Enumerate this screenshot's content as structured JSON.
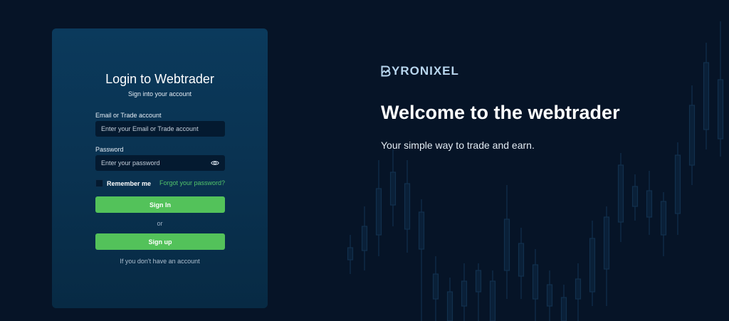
{
  "login": {
    "title": "Login to Webtrader",
    "subtitle": "Sign into your account",
    "email_label": "Email or Trade account",
    "email_placeholder": "Enter your Email or Trade account",
    "password_label": "Password",
    "password_placeholder": "Enter your password",
    "remember_label": "Remember me",
    "forgot_label": "Forgot your password?",
    "signin_label": "Sign In",
    "or_label": "or",
    "signup_label": "Sign up",
    "footnote": "If you don't have an account"
  },
  "hero": {
    "logo_text": "YRONIXEL",
    "title": "Welcome to the webtrader",
    "subtitle": "Your simple way to trade and earn."
  },
  "colors": {
    "background": "#061427",
    "card": "#0b3a5c",
    "accent_green": "#53c25a",
    "link_green": "#52c46a",
    "logo": "#b8d6ee"
  },
  "icons": {
    "password_toggle": "eye-icon",
    "logo_mark": "chart-b-logo-icon"
  }
}
